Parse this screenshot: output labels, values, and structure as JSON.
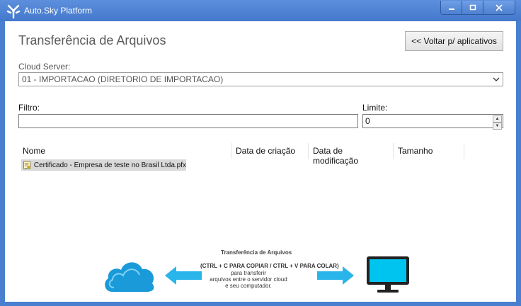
{
  "window": {
    "title": "Auto.Sky Platform",
    "accent": "#4a7fd0"
  },
  "page": {
    "title": "Transferência de Arquivos",
    "back_label": "<< Voltar p/ aplicativos"
  },
  "cloud_server": {
    "label": "Cloud Server:",
    "selected": "01 - IMPORTACAO (DIRETORIO DE IMPORTACAO)"
  },
  "filter": {
    "label": "Filtro:",
    "value": ""
  },
  "limit": {
    "label": "Limite:",
    "value": "0"
  },
  "file_list": {
    "columns": [
      "Nome",
      "Data de criação",
      "Data de modificação",
      "Tamanho"
    ],
    "rows": [
      {
        "name": "Certificado - Empresa de teste no Brasil Ltda.pfx",
        "icon": "certificate-file-icon"
      }
    ]
  },
  "illustration": {
    "title": "Transferência de Arquivos",
    "shortcut": "(CTRL + C PARA COPIAR / CTRL + V PARA COLAR)",
    "desc_1": "para transferir",
    "desc_2": "arquivos entre o servidor cloud",
    "desc_3": "e seu computador.",
    "cloud_color": "#1a9ad8",
    "arrow_color": "#29b5ea",
    "monitor_color": "#00c4f0"
  }
}
